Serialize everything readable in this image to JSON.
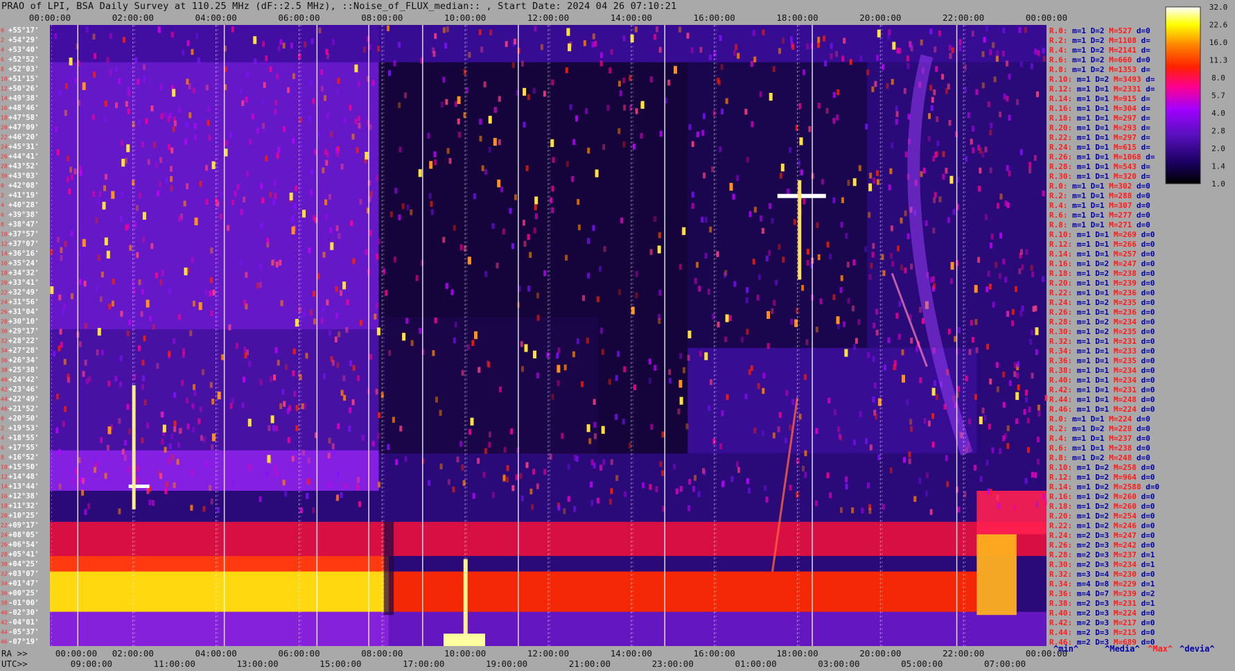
{
  "window": {
    "title": "PRAO of LPI, BSA Daily Survey at 110.25 MHz (dF::2.5 MHz), ::Noise_of_FLUX_median:: , Start Date: 2024 04 26 07:10:21"
  },
  "axis": {
    "bottom_prefix": "RA >>",
    "utc_prefix": "UTC>>"
  },
  "legend": {
    "min_label": "^min^",
    "median_label": "^Media^",
    "max_label": "^Max^",
    "devia_label": "^devia^"
  },
  "colors": {
    "background": "#a9a9a9",
    "label_red": "#ff1a1a",
    "label_blue": "#0000aa",
    "colormap": [
      "#000000",
      "#1a0060",
      "#5a10c0",
      "#a000ff",
      "#ff0090",
      "#ff2000",
      "#ff8000",
      "#ffff00",
      "#ffffff"
    ]
  },
  "chart_data": {
    "type": "heatmap",
    "title": "PRAO of LPI, BSA Daily Survey at 110.25 MHz (dF::2.5 MHz), ::Noise_of_FLUX_median:: , Start Date: 2024 04 26 07:10:21",
    "x_top_ticks": [
      "00:00:00",
      "02:00:00",
      "04:00:00",
      "06:00:00",
      "08:00:00",
      "10:00:00",
      "12:00:00",
      "14:00:00",
      "16:00:00",
      "18:00:00",
      "20:00:00",
      "22:00:00",
      "00:00:00"
    ],
    "x_bottom_ticks": [
      "00:00:00",
      "02:00:00",
      "04:00:00",
      "06:00:00",
      "08:00:00",
      "10:00:00",
      "12:00:00",
      "14:00:00",
      "16:00:00",
      "18:00:00",
      "20:00:00",
      "22:00:00",
      "00:00:00"
    ],
    "x_utc_ticks": [
      "09:00:00",
      "11:00:00",
      "13:00:00",
      "15:00:00",
      "17:00:00",
      "19:00:00",
      "21:00:00",
      "23:00:00",
      "01:00:00",
      "03:00:00",
      "05:00:00",
      "07:00:00"
    ],
    "y_dec_labels": [
      "+55°17'",
      "+54°29'",
      "+53°40'",
      "+52°52'",
      "+52°03'",
      "+51°15'",
      "+50°26'",
      "+49°38'",
      "+48°46'",
      "+47°58'",
      "+47°09'",
      "+46°20'",
      "+45°31'",
      "+44°41'",
      "+43°52'",
      "+43°03'",
      "+42°08'",
      "+41°19'",
      "+40°28'",
      "+39°38'",
      "+38°47'",
      "+37°57'",
      "+37°07'",
      "+36°16'",
      "+35°24'",
      "+34°32'",
      "+33°41'",
      "+32°49'",
      "+31°56'",
      "+31°04'",
      "+30°10'",
      "+29°17'",
      "+28°22'",
      "+27°28'",
      "+26°34'",
      "+25°38'",
      "+24°42'",
      "+23°46'",
      "+22°49'",
      "+21°52'",
      "+20°50'",
      "+19°53'",
      "+18°55'",
      "+17°55'",
      "+16°52'",
      "+15°50'",
      "+14°48'",
      "+13°44'",
      "+12°38'",
      "+11°32'",
      "+10°25'",
      "+09°17'",
      "+08°05'",
      "+06°54'",
      "+05°41'",
      "+04°25'",
      "+03°07'",
      "+01°47'",
      "+00°25'",
      "-01°00'",
      "-02°30'",
      "-04°01'",
      "-05°37'",
      "-07°19'"
    ],
    "y_row_numbers": [
      "0",
      "2",
      "4",
      "6",
      "8",
      "10",
      "12",
      "14",
      "16",
      "18",
      "20",
      "22",
      "24",
      "26",
      "28",
      "30",
      "0",
      "2",
      "4",
      "6",
      "8",
      "10",
      "12",
      "14",
      "16",
      "18",
      "20",
      "22",
      "24",
      "26",
      "28",
      "30",
      "32",
      "34",
      "36",
      "38",
      "40",
      "42",
      "44",
      "46",
      "0",
      "2",
      "4",
      "6",
      "8",
      "10",
      "12",
      "14",
      "16",
      "18",
      "20",
      "22",
      "24",
      "26",
      "28",
      "30",
      "32",
      "34",
      "36",
      "38",
      "40",
      "42",
      "44",
      "46"
    ],
    "row_stats": [
      {
        "r": "R.0:",
        "m": "1",
        "d": "2",
        "M": "527",
        "dev": "0"
      },
      {
        "r": "R.2:",
        "m": "1",
        "d": "2",
        "M": "1108",
        "dev": ""
      },
      {
        "r": "R.4:",
        "m": "1",
        "d": "2",
        "M": "2141",
        "dev": ""
      },
      {
        "r": "R.6:",
        "m": "1",
        "d": "2",
        "M": "660",
        "dev": "0"
      },
      {
        "r": "R.8:",
        "m": "1",
        "d": "2",
        "M": "1353",
        "dev": ""
      },
      {
        "r": "R.10:",
        "m": "1",
        "d": "2",
        "M": "3493",
        "dev": ""
      },
      {
        "r": "R.12:",
        "m": "1",
        "d": "1",
        "M": "2331",
        "dev": ""
      },
      {
        "r": "R.14:",
        "m": "1",
        "d": "1",
        "M": "915",
        "dev": ""
      },
      {
        "r": "R.16:",
        "m": "1",
        "d": "1",
        "M": "304",
        "dev": ""
      },
      {
        "r": "R.18:",
        "m": "1",
        "d": "1",
        "M": "297",
        "dev": ""
      },
      {
        "r": "R.20:",
        "m": "1",
        "d": "1",
        "M": "293",
        "dev": ""
      },
      {
        "r": "R.22:",
        "m": "1",
        "d": "1",
        "M": "297",
        "dev": ""
      },
      {
        "r": "R.24:",
        "m": "1",
        "d": "1",
        "M": "615",
        "dev": ""
      },
      {
        "r": "R.26:",
        "m": "1",
        "d": "1",
        "M": "1068",
        "dev": ""
      },
      {
        "r": "R.28:",
        "m": "1",
        "d": "1",
        "M": "543",
        "dev": ""
      },
      {
        "r": "R.30:",
        "m": "1",
        "d": "1",
        "M": "320",
        "dev": ""
      },
      {
        "r": "R.0:",
        "m": "1",
        "d": "1",
        "M": "302",
        "dev": "0"
      },
      {
        "r": "R.2:",
        "m": "1",
        "d": "1",
        "M": "288",
        "dev": "0"
      },
      {
        "r": "R.4:",
        "m": "1",
        "d": "1",
        "M": "307",
        "dev": "0"
      },
      {
        "r": "R.6:",
        "m": "1",
        "d": "1",
        "M": "277",
        "dev": "0"
      },
      {
        "r": "R.8:",
        "m": "1",
        "d": "1",
        "M": "271",
        "dev": "0"
      },
      {
        "r": "R.10:",
        "m": "1",
        "d": "1",
        "M": "269",
        "dev": "0"
      },
      {
        "r": "R.12:",
        "m": "1",
        "d": "1",
        "M": "266",
        "dev": "0"
      },
      {
        "r": "R.14:",
        "m": "1",
        "d": "1",
        "M": "257",
        "dev": "0"
      },
      {
        "r": "R.16:",
        "m": "1",
        "d": "2",
        "M": "247",
        "dev": "0"
      },
      {
        "r": "R.18:",
        "m": "1",
        "d": "2",
        "M": "238",
        "dev": "0"
      },
      {
        "r": "R.20:",
        "m": "1",
        "d": "1",
        "M": "239",
        "dev": "0"
      },
      {
        "r": "R.22:",
        "m": "1",
        "d": "1",
        "M": "236",
        "dev": "0"
      },
      {
        "r": "R.24:",
        "m": "1",
        "d": "2",
        "M": "235",
        "dev": "0"
      },
      {
        "r": "R.26:",
        "m": "1",
        "d": "1",
        "M": "236",
        "dev": "0"
      },
      {
        "r": "R.28:",
        "m": "1",
        "d": "2",
        "M": "234",
        "dev": "0"
      },
      {
        "r": "R.30:",
        "m": "1",
        "d": "2",
        "M": "235",
        "dev": "0"
      },
      {
        "r": "R.32:",
        "m": "1",
        "d": "1",
        "M": "231",
        "dev": "0"
      },
      {
        "r": "R.34:",
        "m": "1",
        "d": "1",
        "M": "233",
        "dev": "0"
      },
      {
        "r": "R.36:",
        "m": "1",
        "d": "1",
        "M": "235",
        "dev": "0"
      },
      {
        "r": "R.38:",
        "m": "1",
        "d": "1",
        "M": "234",
        "dev": "0"
      },
      {
        "r": "R.40:",
        "m": "1",
        "d": "1",
        "M": "234",
        "dev": "0"
      },
      {
        "r": "R.42:",
        "m": "1",
        "d": "1",
        "M": "231",
        "dev": "0"
      },
      {
        "r": "R.44:",
        "m": "1",
        "d": "1",
        "M": "248",
        "dev": "0"
      },
      {
        "r": "R.46:",
        "m": "1",
        "d": "1",
        "M": "224",
        "dev": "0"
      },
      {
        "r": "R.0:",
        "m": "1",
        "d": "1",
        "M": "224",
        "dev": "0"
      },
      {
        "r": "R.2:",
        "m": "1",
        "d": "2",
        "M": "228",
        "dev": "0"
      },
      {
        "r": "R.4:",
        "m": "1",
        "d": "1",
        "M": "237",
        "dev": "0"
      },
      {
        "r": "R.6:",
        "m": "1",
        "d": "1",
        "M": "238",
        "dev": "0"
      },
      {
        "r": "R.8:",
        "m": "1",
        "d": "2",
        "M": "248",
        "dev": "0"
      },
      {
        "r": "R.10:",
        "m": "1",
        "d": "2",
        "M": "258",
        "dev": "0"
      },
      {
        "r": "R.12:",
        "m": "1",
        "d": "2",
        "M": "964",
        "dev": "0"
      },
      {
        "r": "R.14:",
        "m": "1",
        "d": "2",
        "M": "2588",
        "dev": "0"
      },
      {
        "r": "R.16:",
        "m": "1",
        "d": "2",
        "M": "260",
        "dev": "0"
      },
      {
        "r": "R.18:",
        "m": "1",
        "d": "2",
        "M": "260",
        "dev": "0"
      },
      {
        "r": "R.20:",
        "m": "1",
        "d": "2",
        "M": "254",
        "dev": "0"
      },
      {
        "r": "R.22:",
        "m": "1",
        "d": "2",
        "M": "246",
        "dev": "0"
      },
      {
        "r": "R.24:",
        "m": "2",
        "d": "3",
        "M": "247",
        "dev": "0"
      },
      {
        "r": "R.26:",
        "m": "2",
        "d": "3",
        "M": "242",
        "dev": "0"
      },
      {
        "r": "R.28:",
        "m": "2",
        "d": "3",
        "M": "237",
        "dev": "1"
      },
      {
        "r": "R.30:",
        "m": "2",
        "d": "3",
        "M": "234",
        "dev": "1"
      },
      {
        "r": "R.32:",
        "m": "3",
        "d": "4",
        "M": "230",
        "dev": "0"
      },
      {
        "r": "R.34:",
        "m": "4",
        "d": "8",
        "M": "229",
        "dev": "1"
      },
      {
        "r": "R.36:",
        "m": "4",
        "d": "7",
        "M": "239",
        "dev": "2"
      },
      {
        "r": "R.38:",
        "m": "2",
        "d": "3",
        "M": "231",
        "dev": "1"
      },
      {
        "r": "R.40:",
        "m": "2",
        "d": "3",
        "M": "224",
        "dev": "0"
      },
      {
        "r": "R.42:",
        "m": "2",
        "d": "3",
        "M": "217",
        "dev": "0"
      },
      {
        "r": "R.44:",
        "m": "2",
        "d": "3",
        "M": "215",
        "dev": "0"
      },
      {
        "r": "R.46:",
        "m": "2",
        "d": "3",
        "M": "689",
        "dev": "0"
      }
    ],
    "colorbar": {
      "ticks": [
        "32.0",
        "22.6",
        "16.0",
        "11.3",
        "8.0",
        "5.7",
        "4.0",
        "2.8",
        "2.0",
        "1.4",
        "1.0"
      ],
      "scale": "log"
    },
    "stat_keys": {
      "min": "m=",
      "median": "D=",
      "max": "M=",
      "devia": "d="
    }
  }
}
